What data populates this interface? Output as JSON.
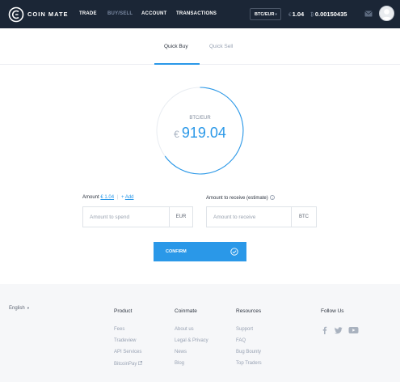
{
  "brand": {
    "name": "COIN MATE"
  },
  "nav": {
    "items": [
      {
        "label": "TRADE",
        "active": false
      },
      {
        "label": "BUY/SELL",
        "active": true
      },
      {
        "label": "ACCOUNT",
        "active": false
      },
      {
        "label": "TRANSACTIONS",
        "active": false
      }
    ],
    "pair_selector": "BTC/EUR",
    "balances": [
      {
        "currency_symbol": "€",
        "amount": "1.04"
      },
      {
        "currency_symbol": "₿",
        "amount": "0.00150435"
      }
    ]
  },
  "tabs": [
    {
      "label": "Quick Buy",
      "active": true
    },
    {
      "label": "Quick Sell",
      "active": false
    }
  ],
  "rate": {
    "pair": "BTC/EUR",
    "currency_symbol": "€",
    "value": "919.04"
  },
  "form": {
    "spend": {
      "label": "Amount",
      "balance_link": "€ 1.04",
      "separator": "|",
      "plus": "+",
      "add_link": "Add",
      "placeholder": "Amount to spend",
      "unit": "EUR"
    },
    "receive": {
      "label": "Amount to receive (estimate)",
      "info": "i",
      "placeholder": "Amount to receive",
      "unit": "BTC"
    },
    "confirm_label": "CONFIRM"
  },
  "footer": {
    "language": "English",
    "columns": [
      {
        "title": "Product",
        "links": [
          "Fees",
          "Tradeview",
          "API Services",
          "BitcoinPay"
        ]
      },
      {
        "title": "Coinmate",
        "links": [
          "About us",
          "Legal & Privacy",
          "News",
          "Blog"
        ]
      },
      {
        "title": "Resources",
        "links": [
          "Support",
          "FAQ",
          "Bug Bounty",
          "Top Traders"
        ]
      }
    ],
    "follow_title": "Follow Us",
    "social_icons": [
      "facebook-icon",
      "twitter-icon",
      "youtube-icon"
    ]
  },
  "colors": {
    "nav_bg": "#1b2636",
    "accent": "#2a98e8",
    "footer_bg": "#f6f7f9"
  }
}
